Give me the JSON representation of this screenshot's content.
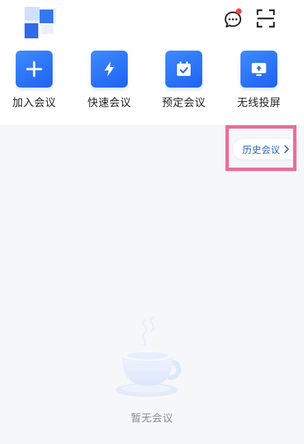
{
  "header": {
    "message_icon": "message-bubble-icon",
    "scan_icon": "scan-icon"
  },
  "actions": [
    {
      "label": "加入会议",
      "icon": "plus-icon"
    },
    {
      "label": "快速会议",
      "icon": "lightning-icon"
    },
    {
      "label": "预定会议",
      "icon": "calendar-check-icon"
    },
    {
      "label": "无线投屏",
      "icon": "screen-cast-icon"
    }
  ],
  "history": {
    "label": "历史会议"
  },
  "empty_state": {
    "text": "暂无会议",
    "icon": "coffee-cup-icon"
  },
  "colors": {
    "accent": "#2d73f5",
    "badge": "#f04848",
    "highlight": "#ec6d99",
    "page_bg": "#f6f7f9"
  }
}
